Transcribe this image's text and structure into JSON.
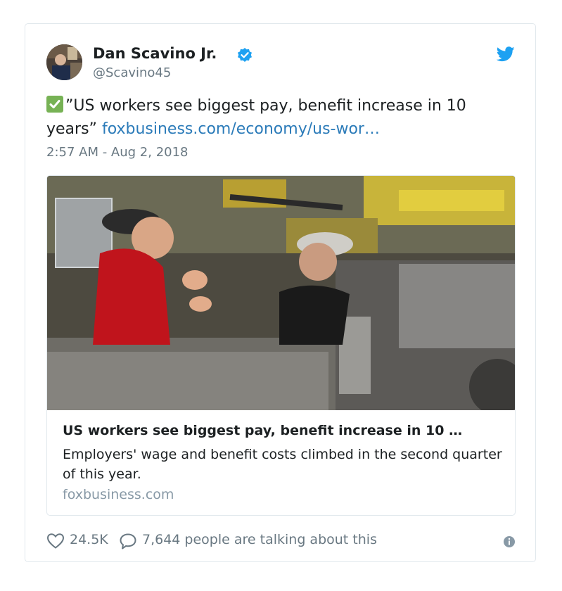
{
  "tweet": {
    "author": {
      "display_name": "Dan Scavino Jr.",
      "handle": "@Scavino45",
      "verified": true
    },
    "text_prefix_emoji": "white-heavy-check-mark",
    "text": "”US workers see biggest pay, benefit increase in 10 years”",
    "link_text": "foxbusiness.com/economy/us-wor…",
    "timestamp": "2:57 AM - Aug 2, 2018",
    "card": {
      "image_alt": "factory-workers-photo",
      "title": "US workers see biggest pay, benefit increase in 10 …",
      "description": "Employers' wage and benefit costs climbed in the second quarter of this year.",
      "domain": "foxbusiness.com"
    },
    "likes": "24.5K",
    "talking": "7,644 people are talking about this"
  },
  "colors": {
    "verified_blue": "#1da1f2",
    "link_blue": "#2b7bb9",
    "muted_gray": "#697882",
    "twitter_blue": "#1da1f2",
    "check_green": "#77b255"
  },
  "icons": [
    "verified-icon",
    "twitter-logo-icon",
    "heart-icon",
    "comment-icon",
    "info-icon"
  ]
}
